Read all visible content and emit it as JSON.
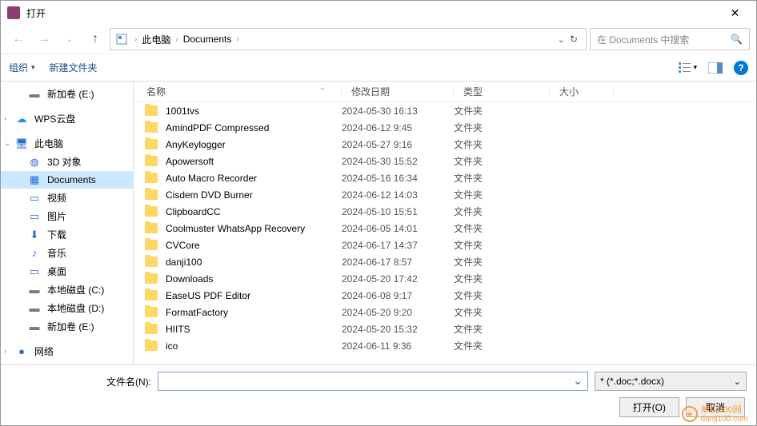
{
  "title": "打开",
  "breadcrumb": [
    "此电脑",
    "Documents"
  ],
  "search_placeholder": "在 Documents 中搜索",
  "toolbar": {
    "organize": "组织",
    "new_folder": "新建文件夹"
  },
  "columns": {
    "name": "名称",
    "date": "修改日期",
    "type": "类型",
    "size": "大小"
  },
  "sidebar": [
    {
      "label": "新加卷 (E:)",
      "icon": "drive",
      "indent": 1
    },
    {
      "spacer": true
    },
    {
      "label": "WPS云盘",
      "icon": "cloud",
      "indent": 0,
      "expandable": true
    },
    {
      "spacer": true
    },
    {
      "label": "此电脑",
      "icon": "pc",
      "indent": 0,
      "expandable": true,
      "expanded": true
    },
    {
      "label": "3D 对象",
      "icon": "3d",
      "indent": 1
    },
    {
      "label": "Documents",
      "icon": "doc",
      "indent": 1,
      "selected": true
    },
    {
      "label": "视频",
      "icon": "video",
      "indent": 1
    },
    {
      "label": "图片",
      "icon": "pic",
      "indent": 1
    },
    {
      "label": "下载",
      "icon": "dl",
      "indent": 1
    },
    {
      "label": "音乐",
      "icon": "music",
      "indent": 1
    },
    {
      "label": "桌面",
      "icon": "desktop",
      "indent": 1
    },
    {
      "label": "本地磁盘 (C:)",
      "icon": "drive",
      "indent": 1
    },
    {
      "label": "本地磁盘 (D:)",
      "icon": "drive",
      "indent": 1
    },
    {
      "label": "新加卷 (E:)",
      "icon": "drive",
      "indent": 1
    },
    {
      "spacer": true
    },
    {
      "label": "网络",
      "icon": "net",
      "indent": 0,
      "expandable": true
    }
  ],
  "files": [
    {
      "name": "1001tvs",
      "date": "2024-05-30 16:13",
      "type": "文件夹"
    },
    {
      "name": "AmindPDF Compressed",
      "date": "2024-06-12 9:45",
      "type": "文件夹"
    },
    {
      "name": "AnyKeylogger",
      "date": "2024-05-27 9:16",
      "type": "文件夹"
    },
    {
      "name": "Apowersoft",
      "date": "2024-05-30 15:52",
      "type": "文件夹"
    },
    {
      "name": "Auto Macro Recorder",
      "date": "2024-05-16 16:34",
      "type": "文件夹"
    },
    {
      "name": "Cisdem DVD Burner",
      "date": "2024-06-12 14:03",
      "type": "文件夹"
    },
    {
      "name": "ClipboardCC",
      "date": "2024-05-10 15:51",
      "type": "文件夹"
    },
    {
      "name": "Coolmuster WhatsApp Recovery",
      "date": "2024-06-05 14:01",
      "type": "文件夹"
    },
    {
      "name": "CVCore",
      "date": "2024-06-17 14:37",
      "type": "文件夹"
    },
    {
      "name": "danji100",
      "date": "2024-06-17 8:57",
      "type": "文件夹"
    },
    {
      "name": "Downloads",
      "date": "2024-05-20 17:42",
      "type": "文件夹"
    },
    {
      "name": "EaseUS PDF Editor",
      "date": "2024-06-08 9:17",
      "type": "文件夹"
    },
    {
      "name": "FormatFactory",
      "date": "2024-05-20 9:20",
      "type": "文件夹"
    },
    {
      "name": "HIITS",
      "date": "2024-05-20 15:32",
      "type": "文件夹"
    },
    {
      "name": "ico",
      "date": "2024-06-11 9:36",
      "type": "文件夹"
    }
  ],
  "bottom": {
    "filename_label": "文件名(N):",
    "filetype": "* (*.doc;*.docx)",
    "open": "打开(O)",
    "cancel": "取消"
  },
  "watermark": {
    "badge": "+",
    "line1": "单机100网",
    "line2": "danji100.com"
  },
  "icons": {
    "drive": "▬",
    "cloud": "☁",
    "pc": "🖥",
    "3d": "◍",
    "doc": "▦",
    "video": "▭",
    "pic": "▭",
    "dl": "⬇",
    "music": "♪",
    "desktop": "▭",
    "net": "●"
  },
  "icon_colors": {
    "drive": "#7a7a7a",
    "cloud": "#1e90ff",
    "pc": "#2a6fd6",
    "3d": "#2a6fd6",
    "doc": "#2a6fd6",
    "video": "#2a6fd6",
    "pic": "#2a6fd6",
    "dl": "#2a6fd6",
    "music": "#2a6fd6",
    "desktop": "#2a6fd6",
    "net": "#2a6fd6"
  }
}
